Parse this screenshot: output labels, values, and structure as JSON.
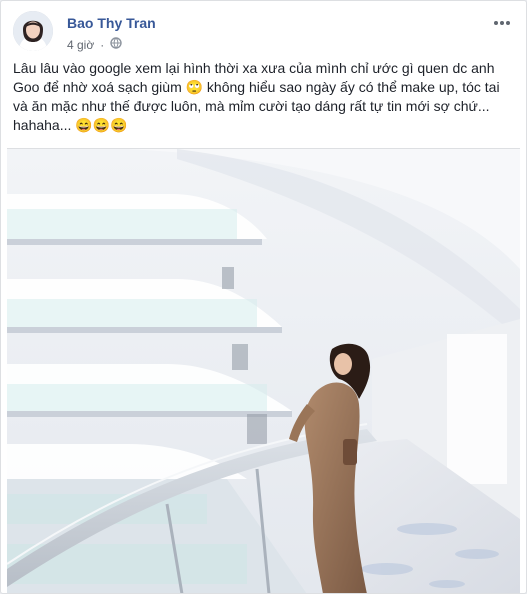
{
  "post": {
    "author": "Bao Thy Tran",
    "time": "4 giờ",
    "text": "Lâu lâu vào google xem lại hình thời xa xưa của mình chỉ ước gì quen dc anh Goo để nhờ xoá sạch giùm 🙄 không hiểu sao ngày ấy có thể make up, tóc tai và ăn mặc như thế được luôn, mà mỉm cười tạo dáng rất tự tin mới sợ chứ... hahaha... 😄😄😄"
  },
  "icons": {
    "more": "more-horizontal-icon",
    "privacy": "globe-icon"
  },
  "colors": {
    "author": "#385898",
    "text": "#1d2129",
    "meta": "#616770"
  }
}
